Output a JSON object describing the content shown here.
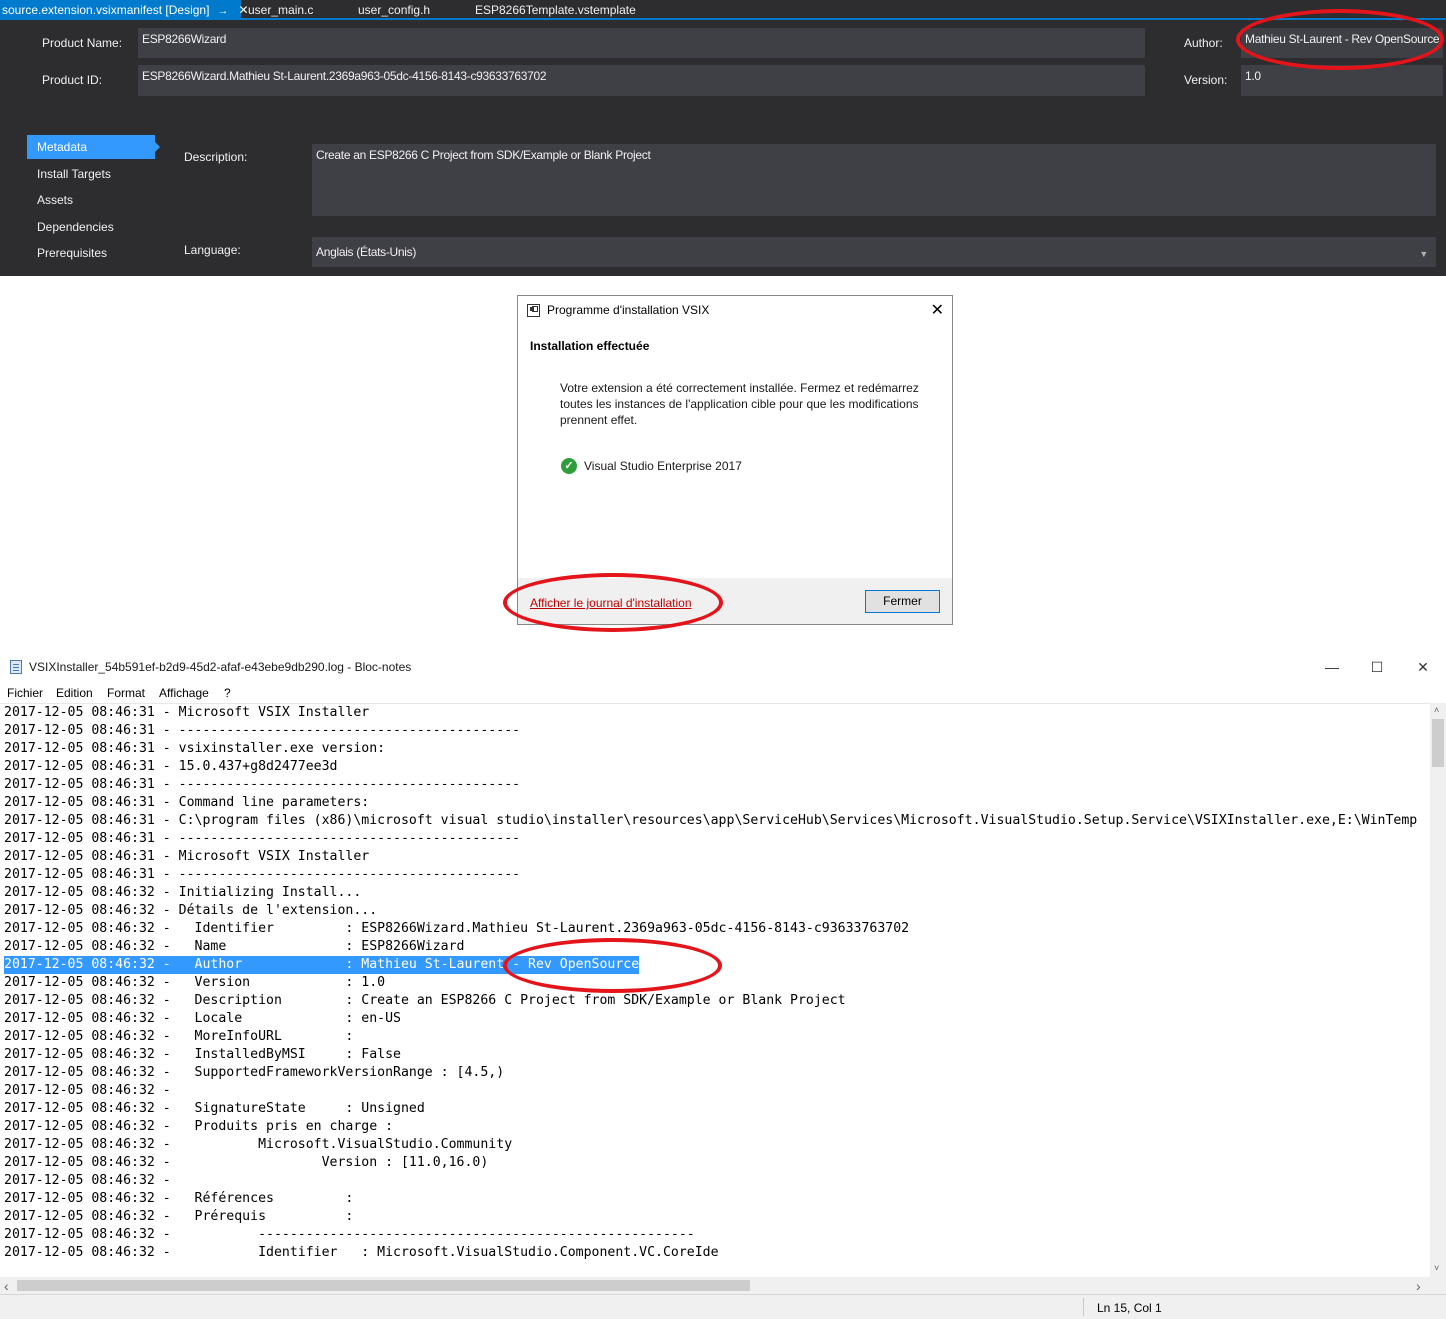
{
  "designer": {
    "tabs": [
      {
        "label": "source.extension.vsixmanifest [Design]",
        "pin": "→",
        "close": "✕"
      },
      {
        "label": "user_main.c"
      },
      {
        "label": "user_config.h"
      },
      {
        "label": "ESP8266Template.vstemplate"
      }
    ],
    "product_name_label": "Product Name:",
    "product_name": "ESP8266Wizard",
    "product_id_label": "Product ID:",
    "product_id": "ESP8266Wizard.Mathieu St-Laurent.2369a963-05dc-4156-8143-c93633763702",
    "author_label": "Author:",
    "author": "Mathieu St-Laurent - Rev OpenSource",
    "version_label": "Version:",
    "version": "1.0",
    "nav": [
      "Metadata",
      "Install Targets",
      "Assets",
      "Dependencies",
      "Prerequisites"
    ],
    "description_label": "Description:",
    "description": "Create an ESP8266 C Project from SDK/Example or Blank Project",
    "language_label": "Language:",
    "language": "Anglais (États-Unis)"
  },
  "dialog": {
    "title": "Programme d'installation VSIX",
    "close": "✕",
    "heading": "Installation effectuée",
    "message": "Votre extension a été correctement installée. Fermez et redémarrez toutes les instances de l'application cible pour que les modifications prennent effet.",
    "check": "✓",
    "product": "Visual Studio Enterprise 2017",
    "log_link": "Afficher le journal d'installation",
    "close_button": "Fermer"
  },
  "notepad": {
    "title": "VSIXInstaller_54b591ef-b2d9-45d2-afaf-e43ebe9db290.log - Bloc-notes",
    "win_min": "—",
    "win_max": "☐",
    "win_close": "✕",
    "menus": [
      "Fichier",
      "Edition",
      "Format",
      "Affichage",
      "?"
    ],
    "lines": [
      "2017-12-05 08:46:31 - Microsoft VSIX Installer",
      "2017-12-05 08:46:31 - -------------------------------------------",
      "2017-12-05 08:46:31 - vsixinstaller.exe version:",
      "2017-12-05 08:46:31 - 15.0.437+g8d2477ee3d",
      "2017-12-05 08:46:31 - -------------------------------------------",
      "2017-12-05 08:46:31 - Command line parameters:",
      "2017-12-05 08:46:31 - C:\\program files (x86)\\microsoft visual studio\\installer\\resources\\app\\ServiceHub\\Services\\Microsoft.VisualStudio.Setup.Service\\VSIXInstaller.exe,E:\\WinTemp",
      "2017-12-05 08:46:31 - -------------------------------------------",
      "2017-12-05 08:46:31 - Microsoft VSIX Installer",
      "2017-12-05 08:46:31 - -------------------------------------------",
      "2017-12-05 08:46:32 - Initializing Install...",
      "2017-12-05 08:46:32 - Détails de l'extension...",
      "2017-12-05 08:46:32 -   Identifier         : ESP8266Wizard.Mathieu St-Laurent.2369a963-05dc-4156-8143-c93633763702",
      "2017-12-05 08:46:32 -   Name               : ESP8266Wizard",
      "2017-12-05 08:46:32 -   Author             : Mathieu St-Laurent - Rev OpenSource",
      "2017-12-05 08:46:32 -   Version            : 1.0",
      "2017-12-05 08:46:32 -   Description        : Create an ESP8266 C Project from SDK/Example or Blank Project",
      "2017-12-05 08:46:32 -   Locale             : en-US",
      "2017-12-05 08:46:32 -   MoreInfoURL        :",
      "2017-12-05 08:46:32 -   InstalledByMSI     : False",
      "2017-12-05 08:46:32 -   SupportedFrameworkVersionRange : [4.5,)",
      "2017-12-05 08:46:32 -",
      "2017-12-05 08:46:32 -   SignatureState     : Unsigned",
      "2017-12-05 08:46:32 -   Produits pris en charge :",
      "2017-12-05 08:46:32 -           Microsoft.VisualStudio.Community",
      "2017-12-05 08:46:32 -                   Version : [11.0,16.0)",
      "2017-12-05 08:46:32 -",
      "2017-12-05 08:46:32 -   Références         :",
      "2017-12-05 08:46:32 -   Prérequis          :",
      "2017-12-05 08:46:32 -           -------------------------------------------------------",
      "2017-12-05 08:46:32 -           Identifier   : Microsoft.VisualStudio.Component.VC.CoreIde"
    ],
    "selected_line_index": 14,
    "status": "Ln 15, Col 1",
    "scroll_left": "‹",
    "scroll_right": "›",
    "scroll_up": "˄",
    "scroll_down": "˅"
  },
  "colors": {
    "vs_background": "#2d2d30",
    "vs_field": "#3f3f46",
    "vs_accent": "#007acc",
    "nav_selected": "#3399ff",
    "annotation_red": "#e4141a",
    "selection": "#3399ff",
    "success_green": "#2e9d3c"
  }
}
